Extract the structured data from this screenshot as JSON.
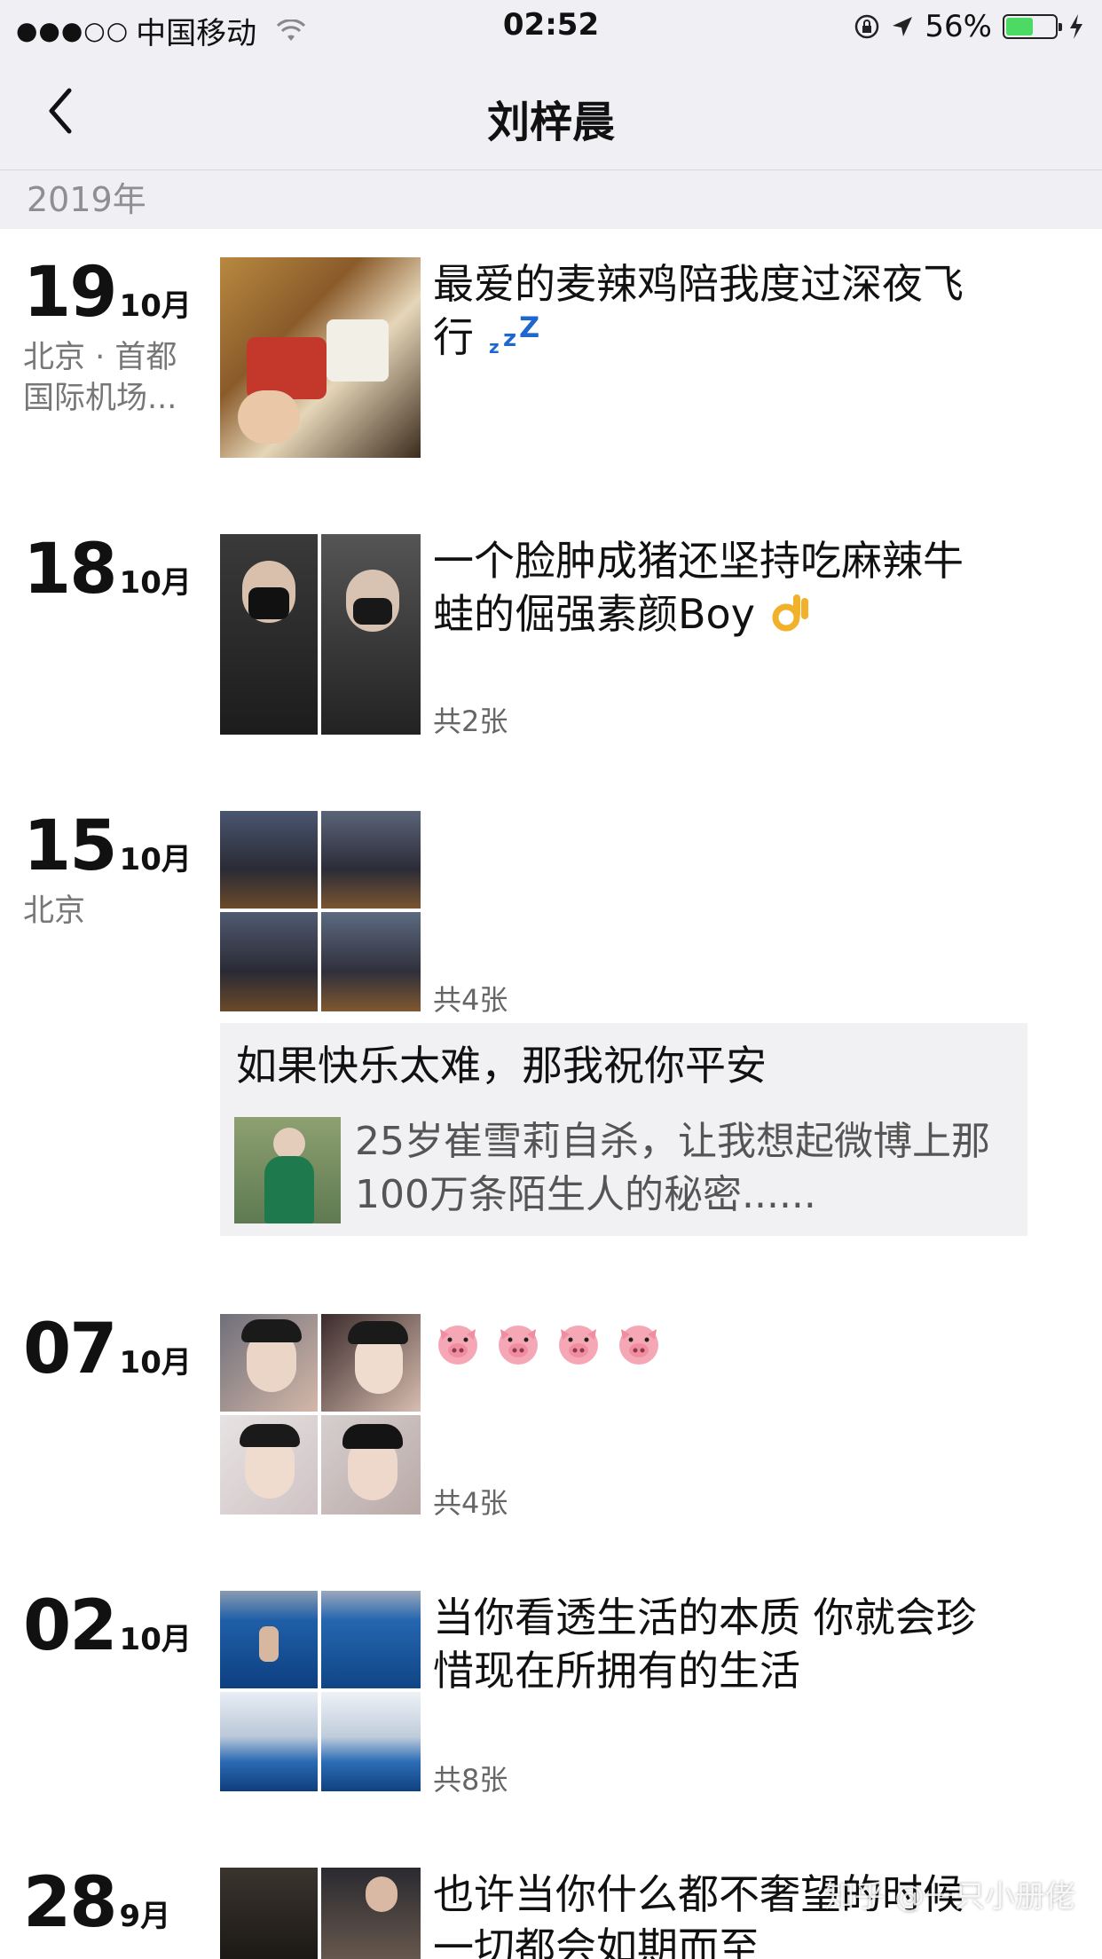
{
  "status_bar": {
    "signal": "●●●○○",
    "carrier": "中国移动",
    "time": "02:52",
    "battery_percent": "56%",
    "battery_level": 0.56,
    "icons": [
      "wifi-icon",
      "rotation-lock-icon",
      "location-arrow-icon",
      "battery-icon",
      "charging-icon"
    ]
  },
  "nav": {
    "title": "刘梓晨",
    "back_icon": "chevron-left-icon"
  },
  "year_header": "2019年",
  "entries": [
    {
      "day": "19",
      "month": "10月",
      "location": "北京 · 首都国际机场...",
      "text": "最爱的麦辣鸡陪我度过深夜飞行",
      "emoji": "zzz",
      "count": ""
    },
    {
      "day": "18",
      "month": "10月",
      "location": "",
      "text": "一个脸肿成猪还坚持吃麻辣牛蛙的倔强素颜Boy",
      "emoji": "ok-hand",
      "count": "共2张"
    },
    {
      "day": "15",
      "month": "10月",
      "location": "北京",
      "text": "",
      "count": "共4张"
    },
    {
      "day": "07",
      "month": "10月",
      "location": "",
      "text": "",
      "emoji": "pig-face ×4",
      "count": "共4张"
    },
    {
      "day": "02",
      "month": "10月",
      "location": "",
      "text": "当你看透生活的本质 你就会珍惜现在所拥有的生活",
      "count": "共8张"
    },
    {
      "day": "28",
      "month": "9月",
      "location": "",
      "text": "也许当你什么都不奢望的时候 一切都会如期而至",
      "count": ""
    }
  ],
  "link_card": {
    "title": "如果快乐太难，那我祝你平安",
    "description": "25岁崔雪莉自杀，让我想起微博上那100万条陌生人的秘密......"
  },
  "watermark": "知乎 @一只小册佬"
}
